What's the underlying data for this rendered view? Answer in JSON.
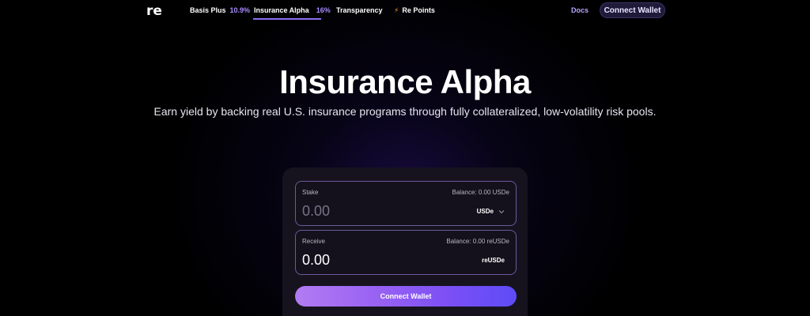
{
  "nav": {
    "logo": "re",
    "items": [
      {
        "label": "Basis Plus",
        "rate": "10.9%"
      },
      {
        "label": "Insurance Alpha",
        "rate": "16%"
      },
      {
        "label": "Transparency"
      },
      {
        "label": "Re Points",
        "icon": "lightning-bolt-icon"
      }
    ],
    "active_item": "Insurance Alpha",
    "docs_label": "Docs",
    "connect_label": "Connect Wallet"
  },
  "hero": {
    "title": "Insurance Alpha",
    "subtitle": "Earn yield by backing real U.S. insurance programs through fully collateralized, low-volatility risk pools."
  },
  "form": {
    "stake": {
      "label": "Stake",
      "balance": "Balance: 0.00 USDe",
      "amount": "0.00",
      "token": "USDe"
    },
    "receive": {
      "label": "Receive",
      "balance": "Balance: 0.00 reUSDe",
      "amount": "0.00",
      "token": "reUSDe"
    },
    "connect_label": "Connect Wallet"
  },
  "colors": {
    "accent": "#8b6cf5",
    "rate": "#a98bff",
    "bolt": "#ff9a2e",
    "button_gradient_start": "#b17cf2",
    "button_gradient_end": "#5d4cf7"
  }
}
